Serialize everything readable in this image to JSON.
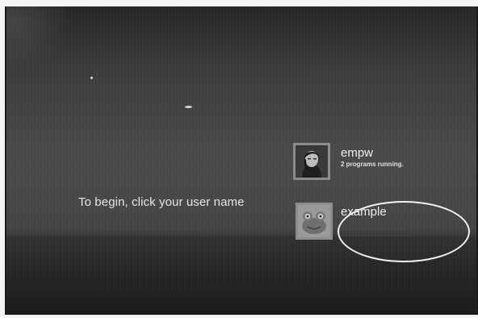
{
  "login": {
    "instruction": "To begin, click your user name",
    "users": [
      {
        "name": "empw",
        "status": "2 programs running.",
        "avatar_icon": "person-photo-icon"
      },
      {
        "name": "example",
        "status": "",
        "avatar_icon": "frog-icon"
      }
    ]
  },
  "colors": {
    "background": "#404040",
    "text": "#f0f0f0",
    "annotation": "#f2f2f2"
  }
}
